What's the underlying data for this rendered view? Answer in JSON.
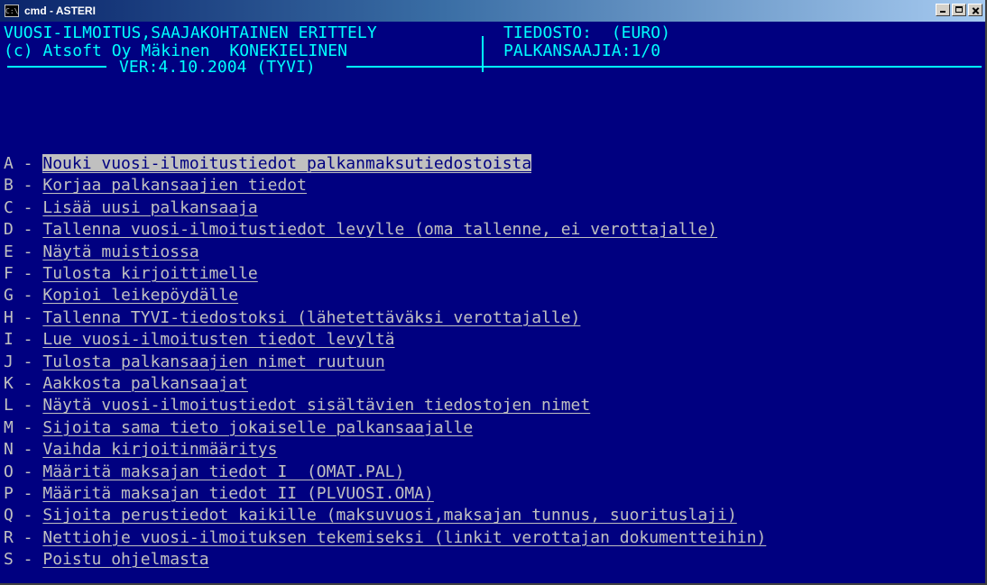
{
  "window": {
    "title": "cmd - ASTERI",
    "icon": "cmd-icon"
  },
  "header": {
    "line1_left": "VUOSI-ILMOITUS,SAAJAKOHTAINEN ERITTELY",
    "line1_right": "TIEDOSTO:  (EURO)",
    "line2_left": "(c) Atsoft Oy Mäkinen  KONEKIELINEN",
    "line2_right": "PALKANSAAJIA:1/0",
    "version": "VER:4.10.2004 (TYVI)"
  },
  "menu": {
    "selected_index": 0,
    "items": [
      {
        "key": "A",
        "label": "Nouki vuosi-ilmoitustiedot palkanmaksutiedostoista"
      },
      {
        "key": "B",
        "label": "Korjaa palkansaajien tiedot"
      },
      {
        "key": "C",
        "label": "Lisää uusi palkansaaja"
      },
      {
        "key": "D",
        "label": "Tallenna vuosi-ilmoitustiedot levylle (oma tallenne, ei verottajalle)"
      },
      {
        "key": "E",
        "label": "Näytä muistiossa"
      },
      {
        "key": "F",
        "label": "Tulosta kirjoittimelle"
      },
      {
        "key": "G",
        "label": "Kopioi leikepöydälle"
      },
      {
        "key": "H",
        "label": "Tallenna TYVI-tiedostoksi (lähetettäväksi verottajalle)"
      },
      {
        "key": "I",
        "label": "Lue vuosi-ilmoitusten tiedot levyltä"
      },
      {
        "key": "J",
        "label": "Tulosta palkansaajien nimet ruutuun"
      },
      {
        "key": "K",
        "label": "Aakkosta palkansaajat"
      },
      {
        "key": "L",
        "label": "Näytä vuosi-ilmoitustiedot sisältävien tiedostojen nimet"
      },
      {
        "key": "M",
        "label": "Sijoita sama tieto jokaiselle palkansaajalle"
      },
      {
        "key": "N",
        "label": "Vaihda kirjoitinmääritys"
      },
      {
        "key": "O",
        "label": "Määritä maksajan tiedot I  (OMAT.PAL)"
      },
      {
        "key": "P",
        "label": "Määritä maksajan tiedot II (PLVUOSI.OMA)"
      },
      {
        "key": "Q",
        "label": "Sijoita perustiedot kaikille (maksuvuosi,maksajan tunnus, suorituslaji)"
      },
      {
        "key": "R",
        "label": "Nettiohje vuosi-ilmoituksen tekemiseksi (linkit verottajan dokumentteihin)"
      },
      {
        "key": "S",
        "label": "Poistu ohjelmasta"
      }
    ]
  },
  "colors": {
    "background": "#000080",
    "text": "#c0c0c0",
    "header": "#00ffff",
    "highlight_bg": "#c0c0c0",
    "highlight_fg": "#000080"
  }
}
